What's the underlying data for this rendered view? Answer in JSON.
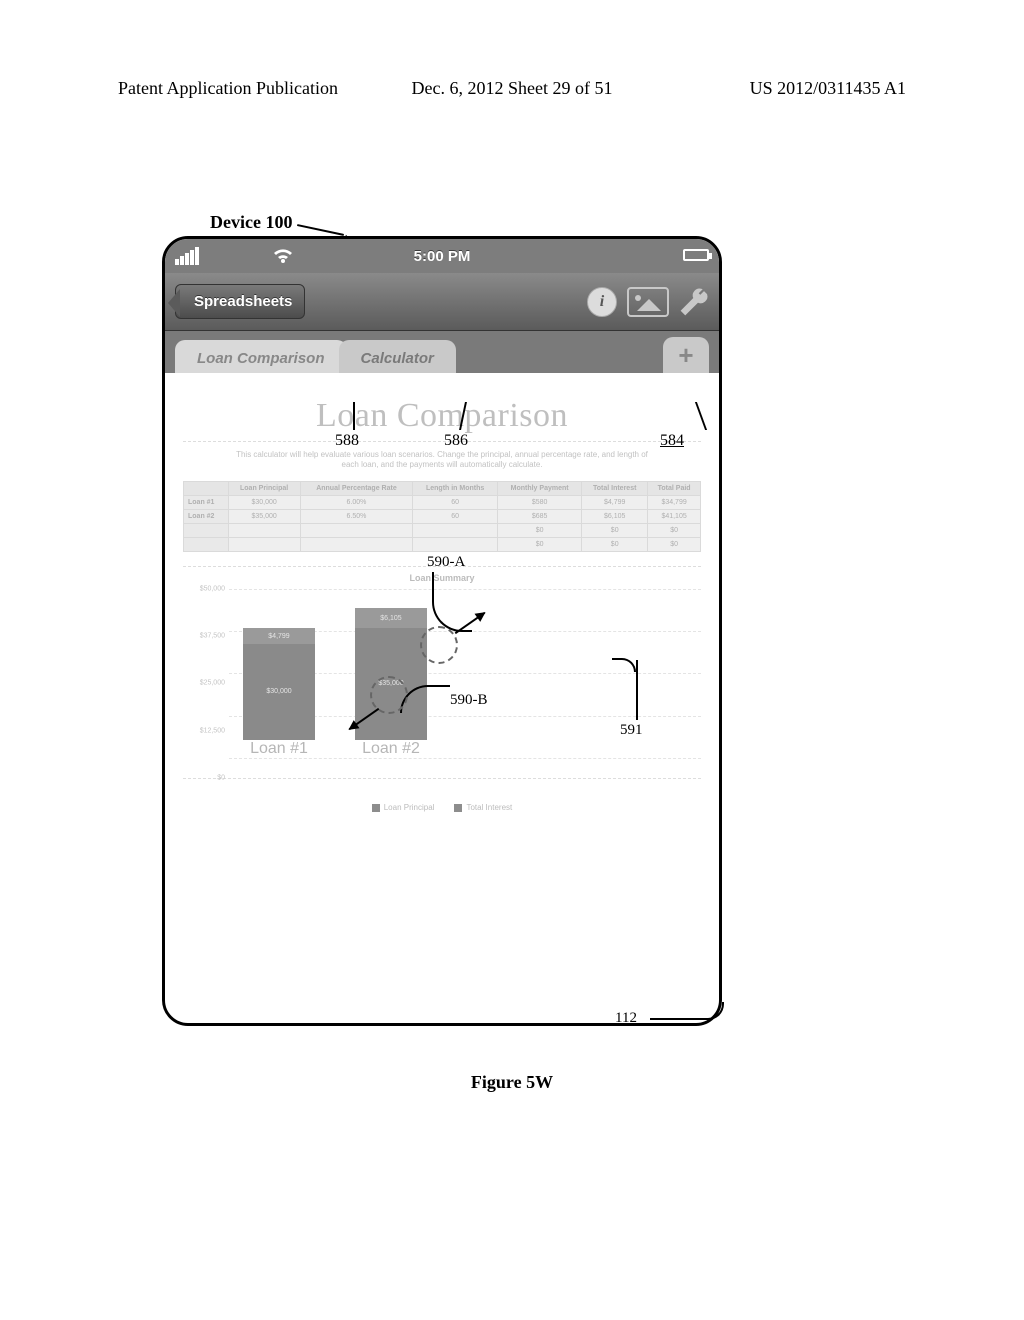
{
  "header": {
    "left": "Patent Application Publication",
    "center": "Dec. 6, 2012   Sheet 29 of 51",
    "right": "US 2012/0311435 A1"
  },
  "device_label": "Device 100",
  "figure_caption": "Figure 5W",
  "status": {
    "time": "5:00 PM"
  },
  "toolbar": {
    "back_label": "Spreadsheets"
  },
  "tabs": {
    "active": "Loan Comparison",
    "inactive": "Calculator",
    "add_label": "+"
  },
  "sheet": {
    "title": "Loan Comparison",
    "desc": "This calculator will help evaluate various loan scenarios. Change the principal, annual percentage rate, and length of each loan, and the payments will automatically calculate.",
    "columns": [
      "",
      "Loan Principal",
      "Annual Percentage Rate",
      "Length in Months",
      "Monthly Payment",
      "Total Interest",
      "Total Paid"
    ],
    "rows": [
      {
        "label": "Loan #1",
        "cells": [
          "$30,000",
          "6.00%",
          "60",
          "$580",
          "$4,799",
          "$34,799"
        ]
      },
      {
        "label": "Loan #2",
        "cells": [
          "$35,000",
          "6.50%",
          "60",
          "$685",
          "$6,105",
          "$41,105"
        ]
      },
      {
        "label": "",
        "cells": [
          "",
          "",
          "",
          "$0",
          "$0",
          "$0"
        ]
      },
      {
        "label": "",
        "cells": [
          "",
          "",
          "",
          "$0",
          "$0",
          "$0"
        ]
      }
    ],
    "summary_title": "Loan Summary",
    "legend": {
      "a": "Loan Principal",
      "b": "Total Interest"
    }
  },
  "chart_data": {
    "type": "bar",
    "title": "Loan Summary",
    "xlabel": "",
    "ylabel": "",
    "ylim": [
      0,
      50000
    ],
    "yticks": [
      "$0",
      "$12,500",
      "$25,000",
      "$37,500",
      "$50,000"
    ],
    "categories": [
      "Loan #1",
      "Loan #2"
    ],
    "series": [
      {
        "name": "Loan Principal",
        "values": [
          30000,
          35000
        ]
      },
      {
        "name": "Total Interest",
        "values": [
          4799,
          6105
        ]
      }
    ],
    "bar_value_labels": [
      [
        "$4,799",
        "$30,000"
      ],
      [
        "$6,105",
        "$35,000"
      ]
    ]
  },
  "callouts": {
    "588": "588",
    "586": "586",
    "584": "584",
    "590a": "590-A",
    "590b": "590-B",
    "591": "591",
    "112": "112"
  }
}
